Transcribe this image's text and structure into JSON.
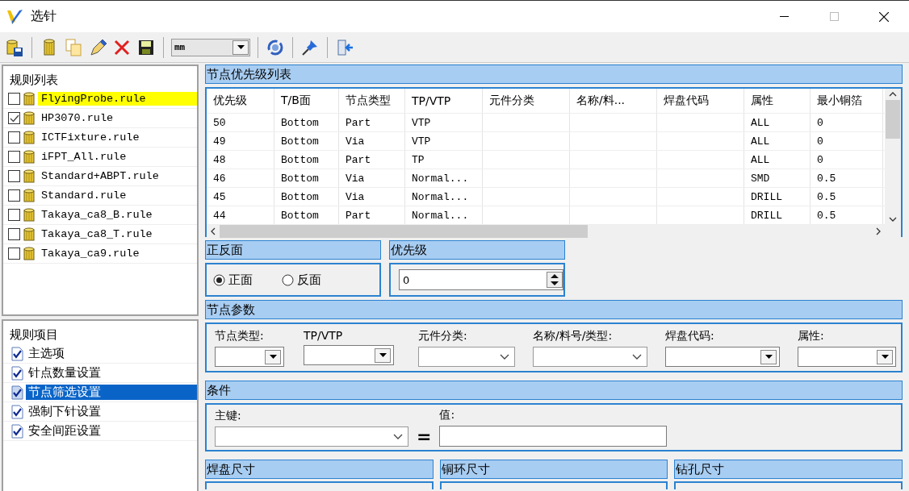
{
  "window": {
    "title": "选针"
  },
  "toolbar": {
    "unit": "mm"
  },
  "rule_list": {
    "title": "规则列表",
    "items": [
      {
        "name": "FlyingProbe.rule",
        "checked": false,
        "selected": true
      },
      {
        "name": "HP3070.rule",
        "checked": true,
        "selected": false
      },
      {
        "name": "ICTFixture.rule",
        "checked": false,
        "selected": false
      },
      {
        "name": "iFPT_All.rule",
        "checked": false,
        "selected": false
      },
      {
        "name": "Standard+ABPT.rule",
        "checked": false,
        "selected": false
      },
      {
        "name": "Standard.rule",
        "checked": false,
        "selected": false
      },
      {
        "name": "Takaya_ca8_B.rule",
        "checked": false,
        "selected": false
      },
      {
        "name": "Takaya_ca8_T.rule",
        "checked": false,
        "selected": false
      },
      {
        "name": "Takaya_ca9.rule",
        "checked": false,
        "selected": false
      }
    ]
  },
  "rule_items": {
    "title": "规则项目",
    "items": [
      {
        "label": "主选项",
        "checked": true,
        "selected": false
      },
      {
        "label": "针点数量设置",
        "checked": true,
        "selected": false
      },
      {
        "label": "节点筛选设置",
        "checked": true,
        "selected": true
      },
      {
        "label": "强制下针设置",
        "checked": true,
        "selected": false
      },
      {
        "label": "安全间距设置",
        "checked": true,
        "selected": false
      }
    ]
  },
  "priority_table": {
    "title": "节点优先级列表",
    "columns": [
      "优先级",
      "T/B面",
      "节点类型",
      "TP/VTP",
      "元件分类",
      "名称/料...",
      "焊盘代码",
      "属性",
      "最小铜箔"
    ],
    "rows": [
      {
        "priority": "50",
        "side": "Bottom",
        "node_type": "Part",
        "tp_vtp": "VTP",
        "attribute": "ALL",
        "min_copper": "0"
      },
      {
        "priority": "49",
        "side": "Bottom",
        "node_type": "Via",
        "tp_vtp": "VTP",
        "attribute": "ALL",
        "min_copper": "0"
      },
      {
        "priority": "48",
        "side": "Bottom",
        "node_type": "Part",
        "tp_vtp": "TP",
        "attribute": "ALL",
        "min_copper": "0"
      },
      {
        "priority": "46",
        "side": "Bottom",
        "node_type": "Via",
        "tp_vtp": "Normal...",
        "attribute": "SMD",
        "min_copper": "0.5"
      },
      {
        "priority": "45",
        "side": "Bottom",
        "node_type": "Via",
        "tp_vtp": "Normal...",
        "attribute": "DRILL",
        "min_copper": "0.5"
      },
      {
        "priority": "44",
        "side": "Bottom",
        "node_type": "Part",
        "tp_vtp": "Normal...",
        "attribute": "DRILL",
        "min_copper": "0.5"
      }
    ]
  },
  "side": {
    "title": "正反面",
    "options": [
      {
        "label": "正面",
        "selected": true
      },
      {
        "label": "反面",
        "selected": false
      }
    ]
  },
  "priority": {
    "title": "优先级",
    "value": "0"
  },
  "node_params": {
    "title": "节点参数",
    "fields": [
      {
        "label": "节点类型:",
        "kind": "classic"
      },
      {
        "label": "TP/VTP",
        "kind": "classic"
      },
      {
        "label": "元件分类:",
        "kind": "flat"
      },
      {
        "label": "名称/料号/类型:",
        "kind": "flat"
      },
      {
        "label": "焊盘代码:",
        "kind": "classic"
      },
      {
        "label": "属性:",
        "kind": "classic"
      }
    ]
  },
  "condition": {
    "title": "条件",
    "key_label": "主键:",
    "equals": "=",
    "value_label": "值:"
  },
  "bottom_sections": [
    "焊盘尺寸",
    "铜环尺寸",
    "钻孔尺寸"
  ]
}
